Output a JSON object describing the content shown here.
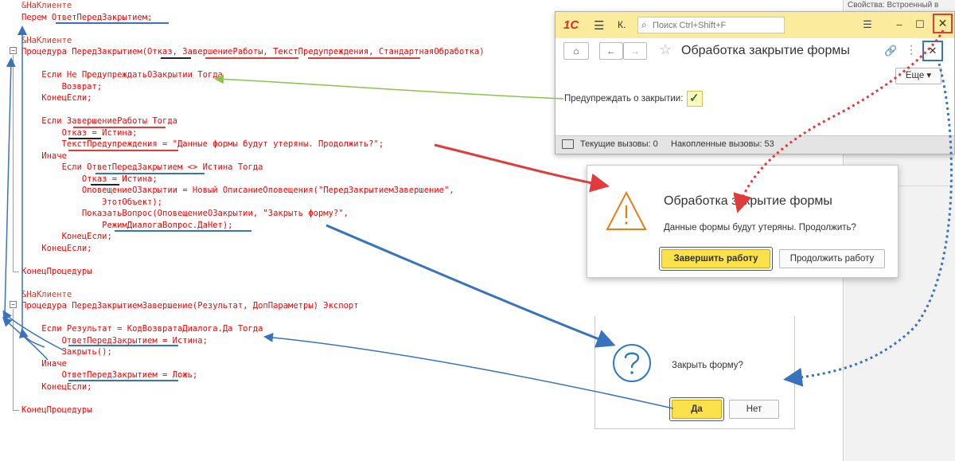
{
  "code": {
    "lines": [
      "&НаКлиенте",
      "Перем ОтветПередЗакрытием;",
      "",
      "&НаКлиенте",
      "Процедура ПередЗакрытием(Отказ, ЗавершениеРаботы, ТекстПредупреждения, СтандартнаяОбработка)",
      "",
      "    Если Не ПредупреждатьОЗакрытии Тогда",
      "        Возврат;",
      "    КонецЕсли;",
      "",
      "    Если ЗавершениеРаботы Тогда",
      "        Отказ = Истина;",
      "        ТекстПредупреждения = \"Данные формы будут утеряны. Продолжить?\";",
      "    Иначе",
      "        Если ОтветПередЗакрытием <> Истина Тогда",
      "            Отказ = Истина;",
      "            ОповещениеОЗакрытии = Новый ОписаниеОповещения(\"ПередЗакрытиемЗавершение\",",
      "                ЭтотОбъект);",
      "            ПоказатьВопрос(ОповещениеОЗакрытии, \"Закрыть форму?\",",
      "                РежимДиалогаВопрос.ДаНет);",
      "        КонецЕсли;",
      "    КонецЕсли;",
      "",
      "КонецПроцедуры",
      "",
      "&НаКлиенте",
      "Процедура ПередЗакрытиемЗавершение(Результат, ДопПараметры) Экспорт",
      "",
      "    Если Результат = КодВозвратаДиалога.Да Тогда",
      "        ОтветПередЗакрытием = Истина;",
      "        Закрыть();",
      "    Иначе",
      "        ОтветПередЗакрытием = Ложь;",
      "    КонецЕсли;",
      "",
      "КонецПроцедуры"
    ],
    "collapse_glyph": "−"
  },
  "props_panel": {
    "title": "Свойства: Встроенный в"
  },
  "app_window": {
    "logo": "1С",
    "menu_glyph": "☰",
    "tab_short": "К.",
    "search_placeholder": "Поиск Ctrl+Shift+F",
    "close_glyph": "✕",
    "form_title": "Обработка закрытие формы",
    "more_button": "Еще ▾",
    "checkbox_label": "Предупреждать о закрытии:",
    "checkbox_checked": true,
    "status_current": "Текущие вызовы: 0",
    "status_accumulated": "Накопленные вызовы: 53"
  },
  "dialog_exit": {
    "title": "Обработка закрытие формы",
    "message": "Данные формы будут утеряны. Продолжить?",
    "primary_button": "Завершить работу",
    "secondary_button": "Продолжить работу"
  },
  "dialog_question": {
    "message": "Закрыть форму?",
    "yes_button": "Да",
    "no_button": "Нет"
  },
  "colors": {
    "keyword_red": "#ff0000",
    "annotation_red": "#e03c3c",
    "annotation_blue": "#3a73bd",
    "annotation_green": "#8bc34a",
    "titlebar_yellow": "#fbeb9c",
    "button_yellow": "#fbe14a"
  }
}
